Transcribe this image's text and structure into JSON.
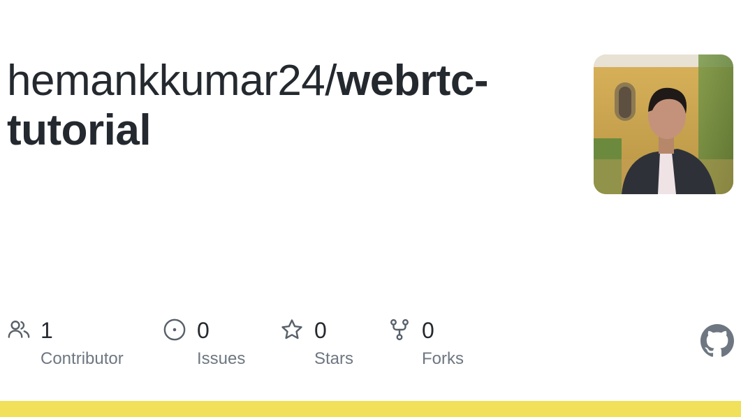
{
  "repo": {
    "owner": "hemankkumar24/",
    "name": "webrtc-tutorial"
  },
  "stats": [
    {
      "count": "1",
      "label": "Contributor",
      "icon": "people-icon"
    },
    {
      "count": "0",
      "label": "Issues",
      "icon": "issue-opened-icon"
    },
    {
      "count": "0",
      "label": "Stars",
      "icon": "star-icon"
    },
    {
      "count": "0",
      "label": "Forks",
      "icon": "repo-forked-icon"
    }
  ],
  "colors": {
    "language_bar": "#f1e05a",
    "text": "#24292f",
    "muted": "#6e7781",
    "icon": "#57606a"
  }
}
